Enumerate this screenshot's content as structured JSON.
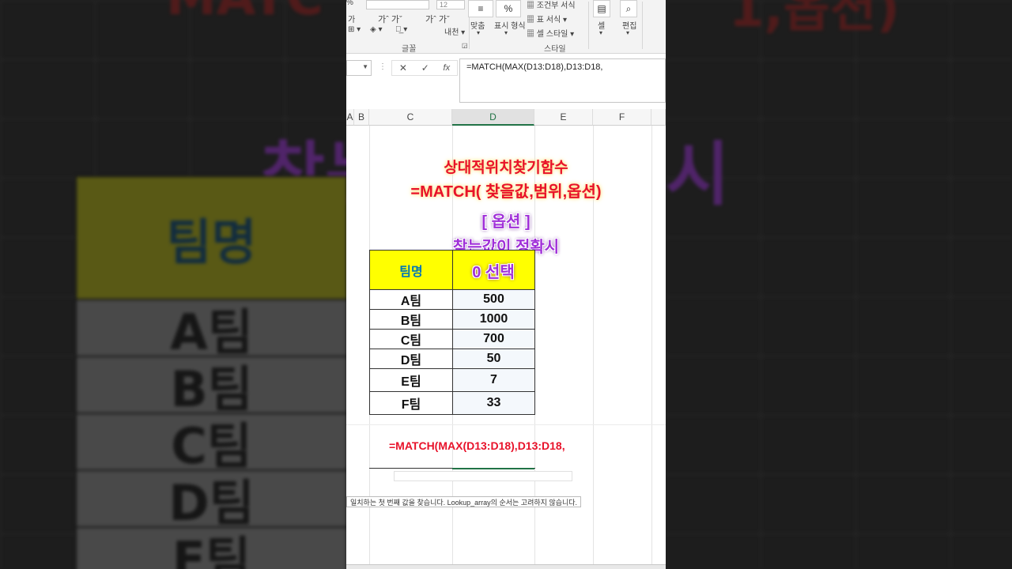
{
  "backdrop": {
    "title_left": "MATC",
    "title_right": "1,옵션)",
    "big_left": "찾는",
    "big_right": "시",
    "table_header": "팀명",
    "table_rows": [
      "A팀",
      "B팀",
      "C팀",
      "D팀",
      "F팀"
    ]
  },
  "ribbon": {
    "font_size": "12",
    "align_label": "맞춤",
    "number_label": "표시 형식",
    "cond_format": "조건부 서식",
    "table_format": "표 서식",
    "cell_style": "셀 스타일",
    "cells_label": "셀",
    "edit_label": "편집",
    "font_group": "글꼴",
    "style_group": "스타일"
  },
  "formula_bar": {
    "cancel": "✕",
    "enter": "✓",
    "fx": "fx",
    "formula": "=MATCH(MAX(D13:D18),D13:D18,"
  },
  "columns": [
    "A",
    "B",
    "C",
    "D",
    "E",
    "F"
  ],
  "overlay": {
    "title": "상대적위치찾기함수",
    "syntax": "=MATCH( 찾을값,범위,옵션)",
    "option_header": "[ 옵션 ]",
    "option_line1": "찾는값이 정확시",
    "option_line2": "0 선택"
  },
  "table": {
    "header_team": "팀명",
    "rows": [
      {
        "team": "A팀",
        "value": "500"
      },
      {
        "team": "B팀",
        "value": "1000"
      },
      {
        "team": "C팀",
        "value": "700"
      },
      {
        "team": "D팀",
        "value": "50"
      },
      {
        "team": "E팀",
        "value": "7"
      },
      {
        "team": "F팀",
        "value": "33"
      }
    ]
  },
  "cell_formula": "=MATCH(MAX(D13:D18),D13:D18,",
  "hint": "일치하는 첫 번째 값을 찾습니다. Lookup_array의 순서는 고려하지 않습니다.",
  "colors": {
    "accent": "#217346",
    "header_fill": "#ffff00",
    "red_text": "#e8122a",
    "purple_text": "#a030d8"
  }
}
